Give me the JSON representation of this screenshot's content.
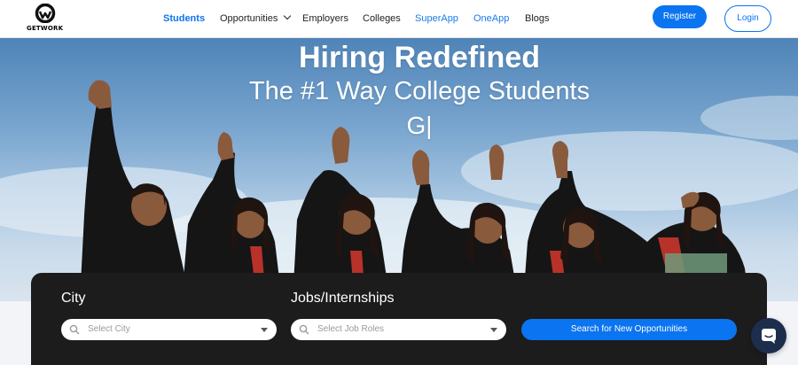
{
  "header": {
    "logo_text": "GETWORK",
    "nav": [
      {
        "label": "Students",
        "state": "active"
      },
      {
        "label": "Opportunities",
        "has_dropdown": true
      },
      {
        "label": "Employers"
      },
      {
        "label": "Colleges"
      },
      {
        "label": "SuperApp",
        "color": "#1a7be8"
      },
      {
        "label": "OneApp",
        "color": "#1a7be8"
      },
      {
        "label": "Blogs"
      }
    ],
    "register_label": "Register",
    "login_label": "Login"
  },
  "hero": {
    "title": "Hiring Redefined",
    "subtitle": "The #1 Way College Students",
    "typed_text": "G|"
  },
  "search": {
    "city_label": "City",
    "city_placeholder": "Select City",
    "jobs_label": "Jobs/Internships",
    "jobs_placeholder": "Select Job Roles",
    "button_label": "Search for New Opportunities"
  },
  "chat": {
    "icon": "chat-icon"
  },
  "colors": {
    "accent": "#0b74f0",
    "panel": "#1c1c1c",
    "chat": "#1d2e4c"
  }
}
